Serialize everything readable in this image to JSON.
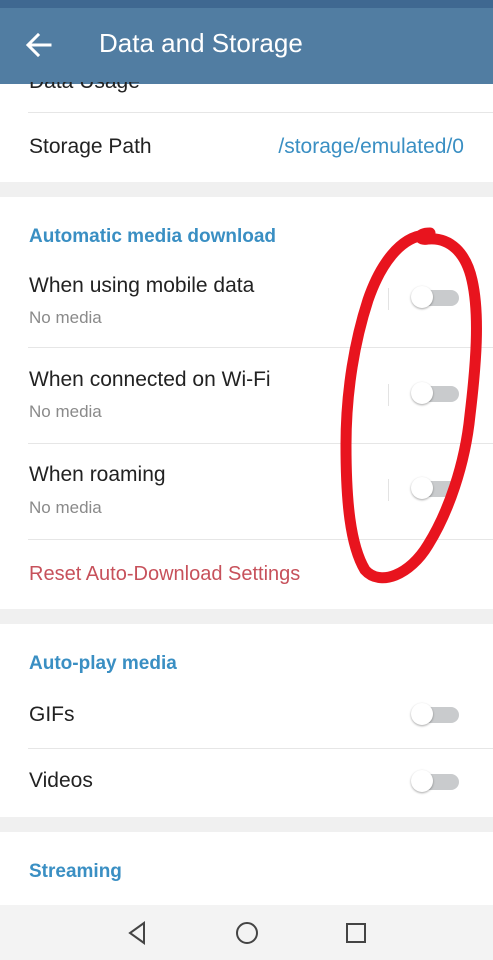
{
  "app_bar": {
    "title": "Data and Storage",
    "back_icon": "arrow-left-icon"
  },
  "storage": {
    "partial_label": "Data Usage",
    "path_label": "Storage Path",
    "path_value": "/storage/emulated/0"
  },
  "auto_download": {
    "header": "Automatic media download",
    "items": [
      {
        "label": "When using mobile data",
        "sub": "No media",
        "enabled": false
      },
      {
        "label": "When connected on Wi-Fi",
        "sub": "No media",
        "enabled": false
      },
      {
        "label": "When roaming",
        "sub": "No media",
        "enabled": false
      }
    ],
    "reset_label": "Reset Auto-Download Settings"
  },
  "autoplay": {
    "header": "Auto-play media",
    "items": [
      {
        "label": "GIFs",
        "enabled": false
      },
      {
        "label": "Videos",
        "enabled": false
      }
    ]
  },
  "streaming": {
    "header": "Streaming"
  },
  "nav": {
    "back_icon": "nav-back-triangle-icon",
    "home_icon": "nav-home-circle-icon",
    "recents_icon": "nav-recents-square-icon"
  },
  "colors": {
    "app_bar": "#517da2",
    "accent_header": "#3a8fc3",
    "reset_text": "#c7515b",
    "annotation": "#e8141e"
  }
}
